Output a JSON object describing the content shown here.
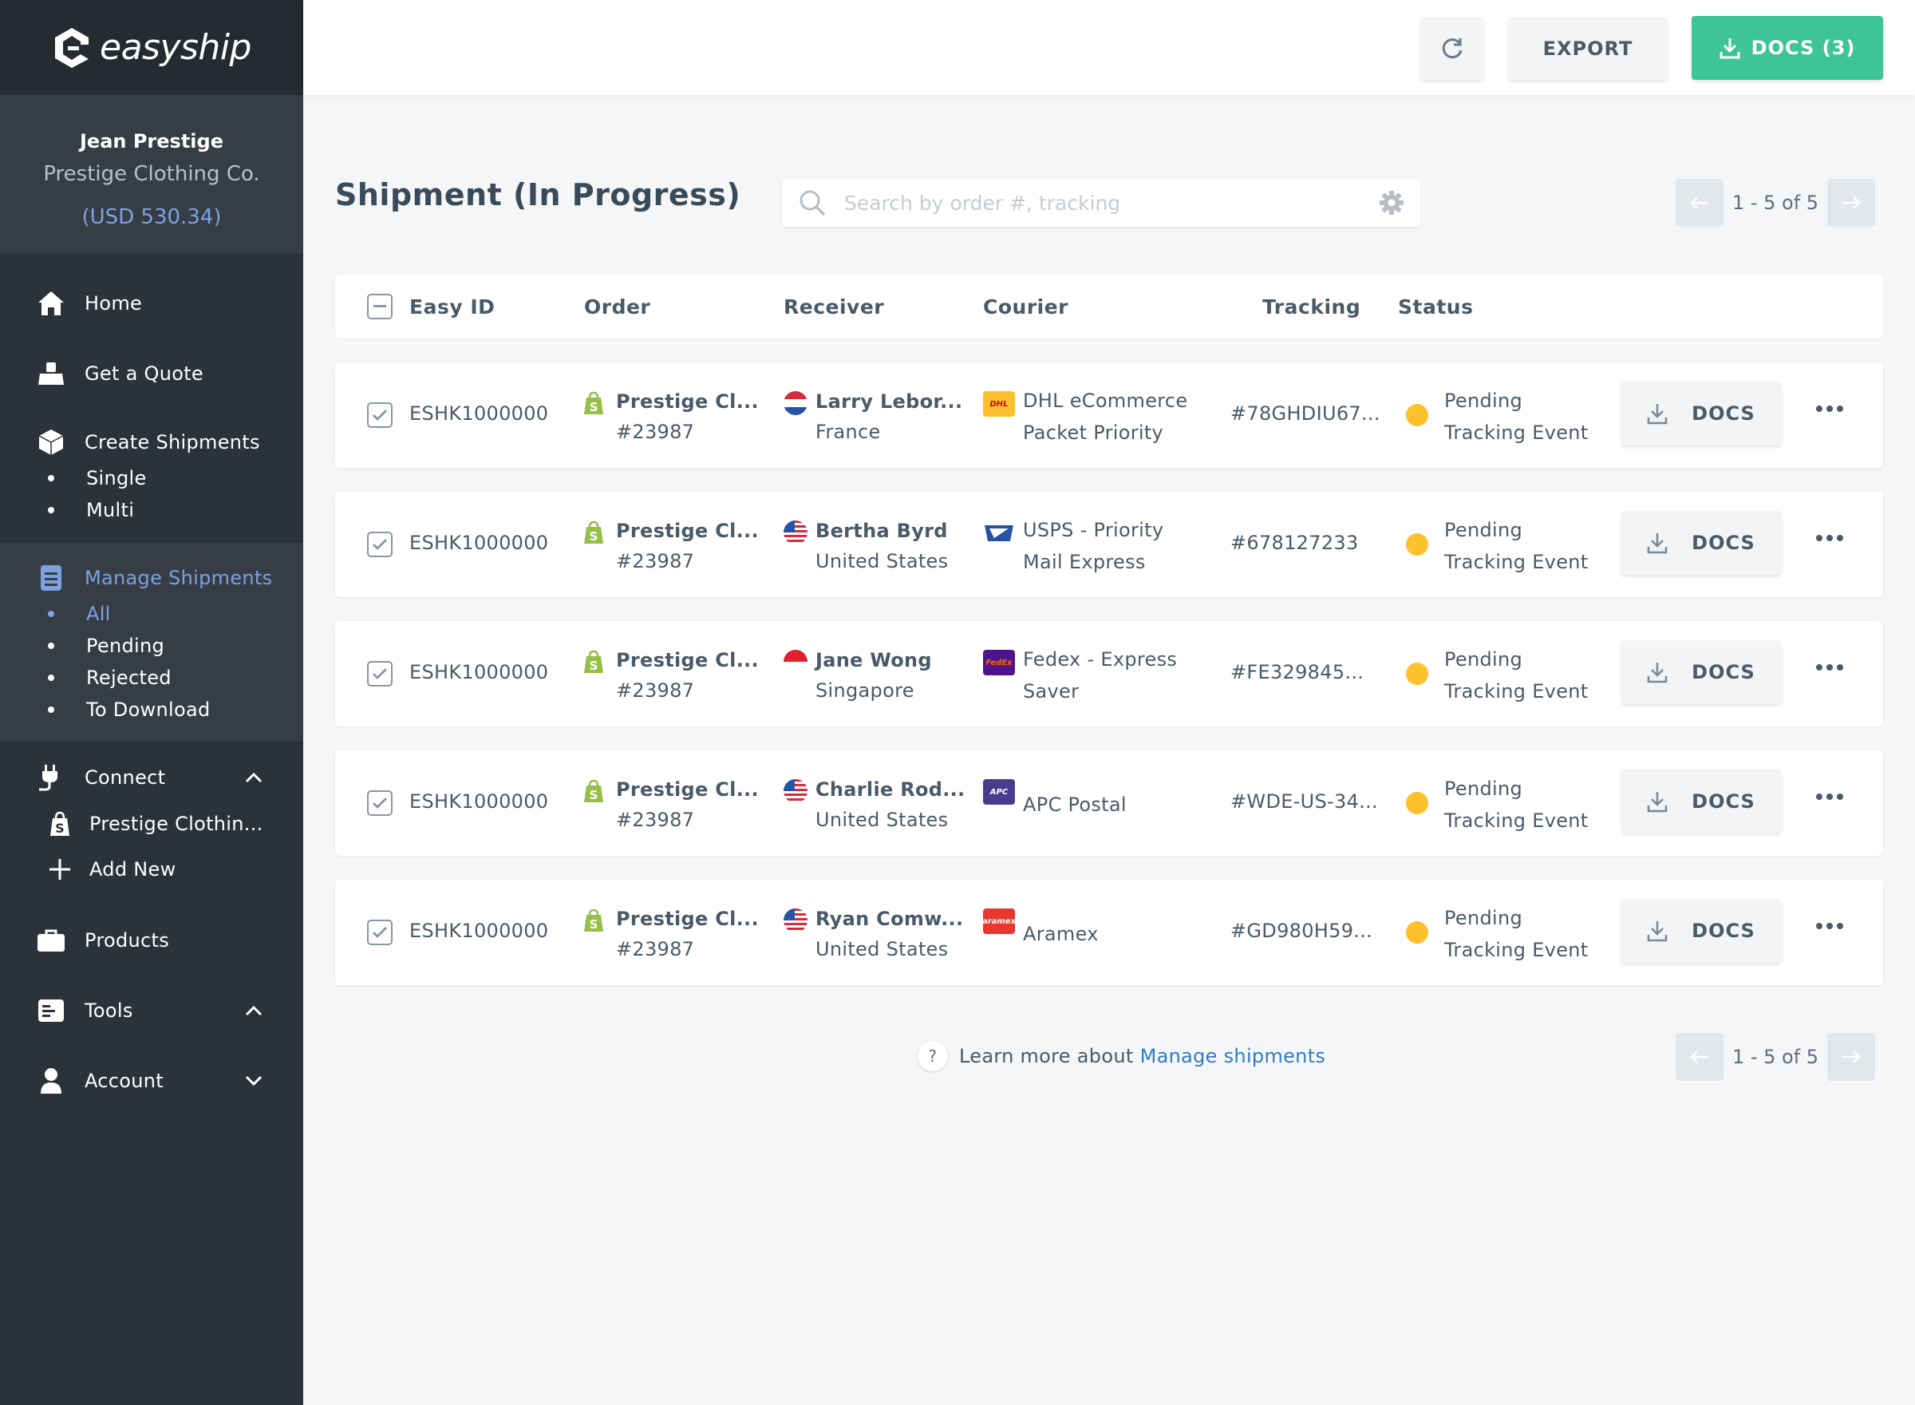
{
  "brand": {
    "name": "easyship"
  },
  "user": {
    "name": "Jean Prestige",
    "company": "Prestige Clothing Co.",
    "balance": "(USD 530.34)"
  },
  "sidebar": {
    "home": "Home",
    "quote": "Get a Quote",
    "create": "Create Shipments",
    "create_subs": [
      "Single",
      "Multi"
    ],
    "manage": "Manage Shipments",
    "manage_subs": [
      "All",
      "Pending",
      "Rejected",
      "To Download"
    ],
    "connect": "Connect",
    "store": "Prestige Clothin...",
    "add_new": "Add New",
    "products": "Products",
    "tools": "Tools",
    "account": "Account"
  },
  "toolbar": {
    "export_label": "EXPORT",
    "docs_label": "DOCS (3)"
  },
  "page": {
    "title": "Shipment (In Progress)"
  },
  "search": {
    "placeholder": "Search by order #, tracking",
    "value": ""
  },
  "pagination": {
    "label": "1 - 5 of 5"
  },
  "table": {
    "headers": {
      "easy_id": "Easy ID",
      "order": "Order",
      "receiver": "Receiver",
      "courier": "Courier",
      "tracking": "Tracking",
      "status": "Status"
    },
    "docs_label": "DOCS",
    "rows": [
      {
        "easy_id": "ESHK1000000",
        "order_store": "Prestige Cl...",
        "order_no": "#23987",
        "receiver_name": "Larry Lebor...",
        "receiver_country": "France",
        "flag": "fr",
        "courier_line1": "DHL eCommerce",
        "courier_line2": "Packet Priority",
        "courier_logo": "dhl",
        "courier_logo_text": "DHL",
        "tracking": "#78GHDIU67...",
        "status_line1": "Pending",
        "status_line2": "Tracking Event"
      },
      {
        "easy_id": "ESHK1000000",
        "order_store": "Prestige Cl...",
        "order_no": "#23987",
        "receiver_name": "Bertha Byrd",
        "receiver_country": "United States",
        "flag": "us",
        "courier_line1": "USPS - Priority",
        "courier_line2": "Mail Express",
        "courier_logo": "usps",
        "courier_logo_text": "",
        "tracking": "#678127233",
        "status_line1": "Pending",
        "status_line2": "Tracking Event"
      },
      {
        "easy_id": "ESHK1000000",
        "order_store": "Prestige Cl...",
        "order_no": "#23987",
        "receiver_name": "Jane Wong",
        "receiver_country": "Singapore",
        "flag": "sg",
        "courier_line1": "Fedex - Express",
        "courier_line2": "Saver",
        "courier_logo": "fedex",
        "courier_logo_text": "FedEx",
        "tracking": "#FE329845...",
        "status_line1": "Pending",
        "status_line2": "Tracking Event"
      },
      {
        "easy_id": "ESHK1000000",
        "order_store": "Prestige Cl...",
        "order_no": "#23987",
        "receiver_name": "Charlie Rod...",
        "receiver_country": "United States",
        "flag": "us",
        "courier_line1": "APC Postal",
        "courier_line2": "",
        "courier_logo": "apc",
        "courier_logo_text": "APC",
        "tracking": "#WDE-US-34...",
        "status_line1": "Pending",
        "status_line2": "Tracking Event"
      },
      {
        "easy_id": "ESHK1000000",
        "order_store": "Prestige Cl...",
        "order_no": "#23987",
        "receiver_name": "Ryan Comw...",
        "receiver_country": "United States",
        "flag": "us",
        "courier_line1": "Aramex",
        "courier_line2": "",
        "courier_logo": "aramex",
        "courier_logo_text": "aramex",
        "tracking": "#GD980H59...",
        "status_line1": "Pending",
        "status_line2": "Tracking Event"
      }
    ]
  },
  "help": {
    "prefix": "Learn more about",
    "link": "Manage shipments",
    "icon": "?"
  },
  "colors": {
    "sidebar": "#2c3239",
    "accent_green": "#3dc497",
    "accent_blue": "#7ea1e0",
    "status_pending": "#fcc12d",
    "link": "#2f7cc4"
  },
  "icons": [
    "refresh-icon",
    "download-icon",
    "search-icon",
    "gear-icon",
    "arrow-left-icon",
    "arrow-right-icon",
    "home-icon",
    "scale-icon",
    "box-icon",
    "clipboard-icon",
    "plug-icon",
    "shopify-icon",
    "plus-icon",
    "briefcase-icon",
    "tools-icon",
    "person-icon",
    "chevron-up-icon",
    "chevron-down-icon",
    "more-icon",
    "help-icon"
  ]
}
